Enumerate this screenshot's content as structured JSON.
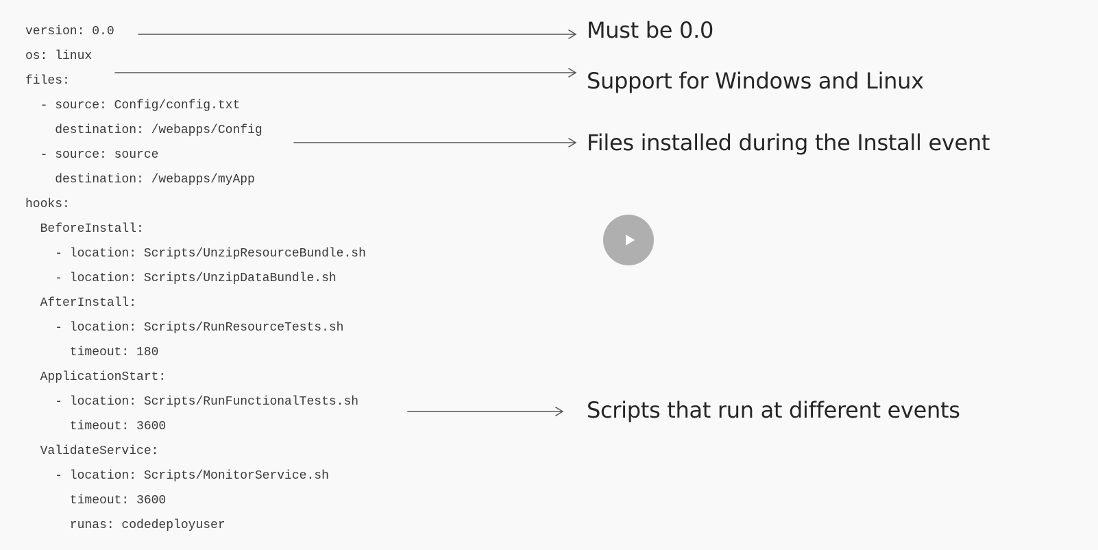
{
  "code_lines": [
    "version: 0.0",
    "os: linux",
    "files:",
    "  - source: Config/config.txt",
    "    destination: /webapps/Config",
    "  - source: source",
    "    destination: /webapps/myApp",
    "hooks:",
    "  BeforeInstall:",
    "    - location: Scripts/UnzipResourceBundle.sh",
    "    - location: Scripts/UnzipDataBundle.sh",
    "  AfterInstall:",
    "    - location: Scripts/RunResourceTests.sh",
    "      timeout: 180",
    "  ApplicationStart:",
    "    - location: Scripts/RunFunctionalTests.sh",
    "      timeout: 3600",
    "  ValidateService:",
    "    - location: Scripts/MonitorService.sh",
    "      timeout: 3600",
    "      runas: codedeployuser"
  ],
  "annotations": {
    "version": "Must be 0.0",
    "os": "Support for Windows and Linux",
    "files": "Files installed during the Install event",
    "hooks": "Scripts that run at different events"
  },
  "icons": {
    "play": "play-icon"
  },
  "colors": {
    "background": "#f9f9f9",
    "code_text": "#3a3a3a",
    "annotation_text": "#262626",
    "arrow": "#555555"
  }
}
